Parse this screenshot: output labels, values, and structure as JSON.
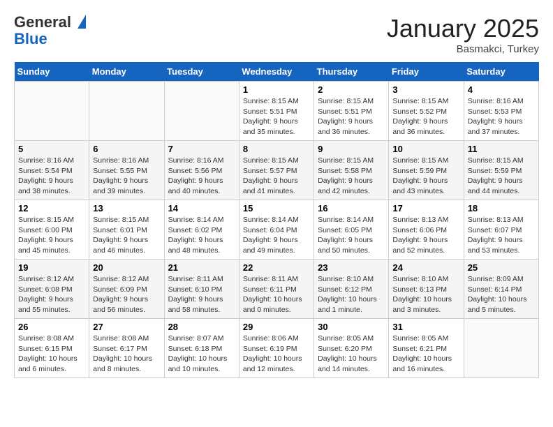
{
  "header": {
    "logo_line1": "General",
    "logo_line2": "Blue",
    "month": "January 2025",
    "location": "Basmakci, Turkey"
  },
  "weekdays": [
    "Sunday",
    "Monday",
    "Tuesday",
    "Wednesday",
    "Thursday",
    "Friday",
    "Saturday"
  ],
  "weeks": [
    [
      {
        "day": "",
        "info": ""
      },
      {
        "day": "",
        "info": ""
      },
      {
        "day": "",
        "info": ""
      },
      {
        "day": "1",
        "info": "Sunrise: 8:15 AM\nSunset: 5:51 PM\nDaylight: 9 hours\nand 35 minutes."
      },
      {
        "day": "2",
        "info": "Sunrise: 8:15 AM\nSunset: 5:51 PM\nDaylight: 9 hours\nand 36 minutes."
      },
      {
        "day": "3",
        "info": "Sunrise: 8:15 AM\nSunset: 5:52 PM\nDaylight: 9 hours\nand 36 minutes."
      },
      {
        "day": "4",
        "info": "Sunrise: 8:16 AM\nSunset: 5:53 PM\nDaylight: 9 hours\nand 37 minutes."
      }
    ],
    [
      {
        "day": "5",
        "info": "Sunrise: 8:16 AM\nSunset: 5:54 PM\nDaylight: 9 hours\nand 38 minutes."
      },
      {
        "day": "6",
        "info": "Sunrise: 8:16 AM\nSunset: 5:55 PM\nDaylight: 9 hours\nand 39 minutes."
      },
      {
        "day": "7",
        "info": "Sunrise: 8:16 AM\nSunset: 5:56 PM\nDaylight: 9 hours\nand 40 minutes."
      },
      {
        "day": "8",
        "info": "Sunrise: 8:15 AM\nSunset: 5:57 PM\nDaylight: 9 hours\nand 41 minutes."
      },
      {
        "day": "9",
        "info": "Sunrise: 8:15 AM\nSunset: 5:58 PM\nDaylight: 9 hours\nand 42 minutes."
      },
      {
        "day": "10",
        "info": "Sunrise: 8:15 AM\nSunset: 5:59 PM\nDaylight: 9 hours\nand 43 minutes."
      },
      {
        "day": "11",
        "info": "Sunrise: 8:15 AM\nSunset: 5:59 PM\nDaylight: 9 hours\nand 44 minutes."
      }
    ],
    [
      {
        "day": "12",
        "info": "Sunrise: 8:15 AM\nSunset: 6:00 PM\nDaylight: 9 hours\nand 45 minutes."
      },
      {
        "day": "13",
        "info": "Sunrise: 8:15 AM\nSunset: 6:01 PM\nDaylight: 9 hours\nand 46 minutes."
      },
      {
        "day": "14",
        "info": "Sunrise: 8:14 AM\nSunset: 6:02 PM\nDaylight: 9 hours\nand 48 minutes."
      },
      {
        "day": "15",
        "info": "Sunrise: 8:14 AM\nSunset: 6:04 PM\nDaylight: 9 hours\nand 49 minutes."
      },
      {
        "day": "16",
        "info": "Sunrise: 8:14 AM\nSunset: 6:05 PM\nDaylight: 9 hours\nand 50 minutes."
      },
      {
        "day": "17",
        "info": "Sunrise: 8:13 AM\nSunset: 6:06 PM\nDaylight: 9 hours\nand 52 minutes."
      },
      {
        "day": "18",
        "info": "Sunrise: 8:13 AM\nSunset: 6:07 PM\nDaylight: 9 hours\nand 53 minutes."
      }
    ],
    [
      {
        "day": "19",
        "info": "Sunrise: 8:12 AM\nSunset: 6:08 PM\nDaylight: 9 hours\nand 55 minutes."
      },
      {
        "day": "20",
        "info": "Sunrise: 8:12 AM\nSunset: 6:09 PM\nDaylight: 9 hours\nand 56 minutes."
      },
      {
        "day": "21",
        "info": "Sunrise: 8:11 AM\nSunset: 6:10 PM\nDaylight: 9 hours\nand 58 minutes."
      },
      {
        "day": "22",
        "info": "Sunrise: 8:11 AM\nSunset: 6:11 PM\nDaylight: 10 hours\nand 0 minutes."
      },
      {
        "day": "23",
        "info": "Sunrise: 8:10 AM\nSunset: 6:12 PM\nDaylight: 10 hours\nand 1 minute."
      },
      {
        "day": "24",
        "info": "Sunrise: 8:10 AM\nSunset: 6:13 PM\nDaylight: 10 hours\nand 3 minutes."
      },
      {
        "day": "25",
        "info": "Sunrise: 8:09 AM\nSunset: 6:14 PM\nDaylight: 10 hours\nand 5 minutes."
      }
    ],
    [
      {
        "day": "26",
        "info": "Sunrise: 8:08 AM\nSunset: 6:15 PM\nDaylight: 10 hours\nand 6 minutes."
      },
      {
        "day": "27",
        "info": "Sunrise: 8:08 AM\nSunset: 6:17 PM\nDaylight: 10 hours\nand 8 minutes."
      },
      {
        "day": "28",
        "info": "Sunrise: 8:07 AM\nSunset: 6:18 PM\nDaylight: 10 hours\nand 10 minutes."
      },
      {
        "day": "29",
        "info": "Sunrise: 8:06 AM\nSunset: 6:19 PM\nDaylight: 10 hours\nand 12 minutes."
      },
      {
        "day": "30",
        "info": "Sunrise: 8:05 AM\nSunset: 6:20 PM\nDaylight: 10 hours\nand 14 minutes."
      },
      {
        "day": "31",
        "info": "Sunrise: 8:05 AM\nSunset: 6:21 PM\nDaylight: 10 hours\nand 16 minutes."
      },
      {
        "day": "",
        "info": ""
      }
    ]
  ]
}
